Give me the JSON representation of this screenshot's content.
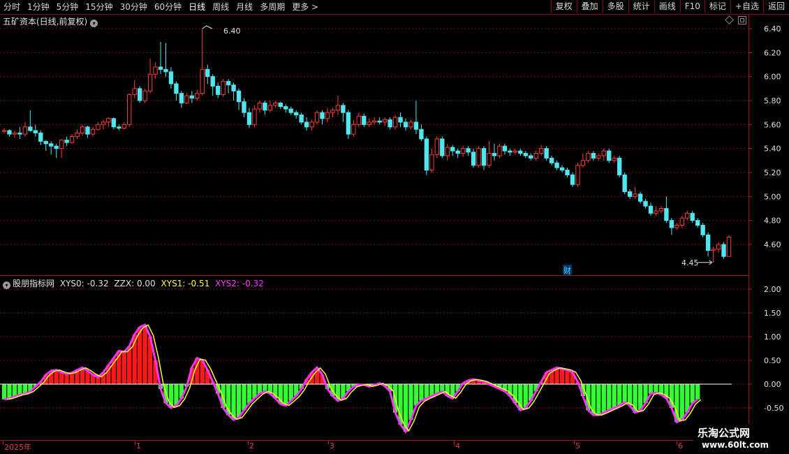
{
  "toolbar": {
    "tabs": [
      "分时",
      "1分钟",
      "5分钟",
      "15分钟",
      "30分钟",
      "60分钟",
      "日线",
      "周线",
      "月线",
      "多周期",
      "更多 >"
    ],
    "active_tab": "日线",
    "right_buttons": [
      "复权",
      "叠加",
      "多股",
      "统计",
      "画线",
      "F10",
      "标记",
      "+自选",
      "返回"
    ]
  },
  "main_chart": {
    "title": "五矿资本(日线,前复权)",
    "high_label": "6.40",
    "low_label": "4.45",
    "finance_marker": "财",
    "price_ticks": [
      "6.40",
      "6.20",
      "6.00",
      "5.80",
      "5.60",
      "5.40",
      "5.20",
      "5.00",
      "4.80",
      "4.60"
    ],
    "colors": {
      "up": "#ff3a3a",
      "down": "#4fe6f0",
      "grid": "#7a1010"
    }
  },
  "indicator": {
    "name": "股朋指标网",
    "xys0_label": "XYS0:",
    "xys0_value": "-0.32",
    "zzx_label": "ZZX:",
    "zzx_value": "0.00",
    "xys1_label": "XYS1:",
    "xys1_value": "-0.51",
    "xys2_label": "XYS2:",
    "xys2_value": "-0.32",
    "ticks": [
      "2.00",
      "1.50",
      "1.00",
      "0.50",
      "0.00",
      "-0.50"
    ],
    "colors": {
      "pos": "#ff1a1a",
      "neg": "#33ff33",
      "line1": "#ffff33",
      "line2": "#ff33ff"
    }
  },
  "date_axis": {
    "labels": [
      "2025年",
      "1",
      "2",
      "3",
      "4",
      "5",
      "6"
    ]
  },
  "watermark": {
    "line1": "乐淘公式网",
    "line2": "www.60lt.com"
  },
  "chart_data": {
    "type": "candlestick",
    "title": "五矿资本(日线,前复权)",
    "ylim": [
      4.45,
      6.45
    ],
    "y_ticks": [
      4.6,
      4.8,
      5.0,
      5.2,
      5.4,
      5.6,
      5.8,
      6.0,
      6.2,
      6.4
    ],
    "max_marker": 6.4,
    "min_marker": 4.45,
    "candles": [
      [
        5.55,
        5.55,
        5.57,
        5.53
      ],
      [
        5.55,
        5.52,
        5.56,
        5.5
      ],
      [
        5.52,
        5.53,
        5.55,
        5.49
      ],
      [
        5.53,
        5.52,
        5.58,
        5.48
      ],
      [
        5.52,
        5.58,
        5.62,
        5.5
      ],
      [
        5.58,
        5.55,
        5.72,
        5.54
      ],
      [
        5.55,
        5.53,
        5.6,
        5.5
      ],
      [
        5.53,
        5.46,
        5.55,
        5.43
      ],
      [
        5.46,
        5.44,
        5.47,
        5.38
      ],
      [
        5.44,
        5.42,
        5.46,
        5.35
      ],
      [
        5.42,
        5.4,
        5.44,
        5.32
      ],
      [
        5.4,
        5.47,
        5.48,
        5.32
      ],
      [
        5.47,
        5.45,
        5.5,
        5.42
      ],
      [
        5.45,
        5.5,
        5.52,
        5.44
      ],
      [
        5.5,
        5.53,
        5.56,
        5.48
      ],
      [
        5.53,
        5.58,
        5.6,
        5.51
      ],
      [
        5.58,
        5.52,
        5.59,
        5.49
      ],
      [
        5.52,
        5.56,
        5.58,
        5.5
      ],
      [
        5.56,
        5.6,
        5.62,
        5.55
      ],
      [
        5.6,
        5.62,
        5.64,
        5.56
      ],
      [
        5.62,
        5.65,
        5.66,
        5.58
      ],
      [
        5.65,
        5.58,
        5.66,
        5.56
      ],
      [
        5.58,
        5.57,
        5.6,
        5.55
      ],
      [
        5.57,
        5.6,
        5.62,
        5.56
      ],
      [
        5.6,
        5.85,
        5.86,
        5.58
      ],
      [
        5.85,
        5.9,
        5.97,
        5.82
      ],
      [
        5.9,
        5.8,
        5.92,
        5.78
      ],
      [
        5.8,
        5.88,
        5.9,
        5.78
      ],
      [
        5.88,
        6.02,
        6.15,
        5.86
      ],
      [
        6.02,
        6.08,
        6.12,
        5.98
      ],
      [
        6.08,
        6.06,
        6.29,
        6.02
      ],
      [
        6.06,
        6.04,
        6.28,
        6.0
      ],
      [
        6.04,
        5.94,
        6.08,
        5.9
      ],
      [
        5.94,
        5.86,
        5.96,
        5.8
      ],
      [
        5.86,
        5.78,
        5.88,
        5.74
      ],
      [
        5.78,
        5.84,
        5.86,
        5.77
      ],
      [
        5.84,
        5.82,
        5.88,
        5.78
      ],
      [
        5.82,
        5.86,
        5.89,
        5.8
      ],
      [
        5.86,
        6.06,
        6.4,
        5.84
      ],
      [
        6.06,
        6.0,
        6.1,
        5.94
      ],
      [
        6.0,
        5.92,
        6.02,
        5.84
      ],
      [
        5.92,
        5.85,
        5.95,
        5.82
      ],
      [
        5.85,
        5.96,
        5.98,
        5.83
      ],
      [
        5.96,
        5.93,
        5.98,
        5.86
      ],
      [
        5.93,
        5.88,
        5.95,
        5.8
      ],
      [
        5.88,
        5.79,
        5.9,
        5.72
      ],
      [
        5.79,
        5.7,
        5.82,
        5.66
      ],
      [
        5.7,
        5.6,
        5.74,
        5.57
      ],
      [
        5.6,
        5.73,
        5.76,
        5.58
      ],
      [
        5.73,
        5.78,
        5.8,
        5.7
      ],
      [
        5.78,
        5.72,
        5.8,
        5.68
      ],
      [
        5.72,
        5.76,
        5.8,
        5.7
      ],
      [
        5.76,
        5.78,
        5.8,
        5.74
      ],
      [
        5.78,
        5.75,
        5.79,
        5.73
      ],
      [
        5.75,
        5.73,
        5.77,
        5.7
      ],
      [
        5.73,
        5.7,
        5.75,
        5.68
      ],
      [
        5.7,
        5.68,
        5.72,
        5.65
      ],
      [
        5.68,
        5.62,
        5.7,
        5.6
      ],
      [
        5.62,
        5.58,
        5.66,
        5.55
      ],
      [
        5.58,
        5.62,
        5.64,
        5.55
      ],
      [
        5.62,
        5.7,
        5.72,
        5.6
      ],
      [
        5.7,
        5.65,
        5.72,
        5.6
      ],
      [
        5.65,
        5.7,
        5.74,
        5.62
      ],
      [
        5.7,
        5.72,
        5.74,
        5.66
      ],
      [
        5.72,
        5.76,
        5.84,
        5.68
      ],
      [
        5.76,
        5.7,
        5.78,
        5.62
      ],
      [
        5.7,
        5.52,
        5.72,
        5.48
      ],
      [
        5.52,
        5.6,
        5.64,
        5.5
      ],
      [
        5.6,
        5.67,
        5.7,
        5.58
      ],
      [
        5.67,
        5.6,
        5.69,
        5.58
      ],
      [
        5.6,
        5.62,
        5.65,
        5.58
      ],
      [
        5.62,
        5.63,
        5.66,
        5.6
      ],
      [
        5.63,
        5.62,
        5.66,
        5.6
      ],
      [
        5.62,
        5.64,
        5.66,
        5.59
      ],
      [
        5.64,
        5.58,
        5.66,
        5.56
      ],
      [
        5.58,
        5.66,
        5.68,
        5.56
      ],
      [
        5.66,
        5.62,
        5.7,
        5.58
      ],
      [
        5.62,
        5.58,
        5.65,
        5.55
      ],
      [
        5.58,
        5.62,
        5.64,
        5.56
      ],
      [
        5.62,
        5.56,
        5.8,
        5.52
      ],
      [
        5.56,
        5.48,
        5.6,
        5.46
      ],
      [
        5.48,
        5.22,
        5.5,
        5.18
      ],
      [
        5.22,
        5.35,
        5.4,
        5.2
      ],
      [
        5.35,
        5.48,
        5.5,
        5.32
      ],
      [
        5.48,
        5.34,
        5.5,
        5.32
      ],
      [
        5.34,
        5.41,
        5.44,
        5.3
      ],
      [
        5.41,
        5.38,
        5.43,
        5.34
      ],
      [
        5.38,
        5.36,
        5.4,
        5.32
      ],
      [
        5.36,
        5.4,
        5.42,
        5.33
      ],
      [
        5.4,
        5.37,
        5.42,
        5.34
      ],
      [
        5.37,
        5.26,
        5.4,
        5.24
      ],
      [
        5.26,
        5.4,
        5.42,
        5.24
      ],
      [
        5.4,
        5.26,
        5.42,
        5.22
      ],
      [
        5.26,
        5.36,
        5.46,
        5.24
      ],
      [
        5.36,
        5.34,
        5.44,
        5.3
      ],
      [
        5.34,
        5.42,
        5.44,
        5.32
      ],
      [
        5.42,
        5.38,
        5.44,
        5.35
      ],
      [
        5.38,
        5.37,
        5.4,
        5.34
      ],
      [
        5.37,
        5.38,
        5.4,
        5.35
      ],
      [
        5.38,
        5.36,
        5.4,
        5.34
      ],
      [
        5.36,
        5.34,
        5.38,
        5.32
      ],
      [
        5.34,
        5.32,
        5.36,
        5.3
      ],
      [
        5.32,
        5.36,
        5.38,
        5.3
      ],
      [
        5.36,
        5.4,
        5.43,
        5.34
      ],
      [
        5.4,
        5.32,
        5.42,
        5.3
      ],
      [
        5.32,
        5.28,
        5.34,
        5.26
      ],
      [
        5.28,
        5.24,
        5.3,
        5.22
      ],
      [
        5.24,
        5.22,
        5.26,
        5.2
      ],
      [
        5.22,
        5.18,
        5.24,
        5.16
      ],
      [
        5.18,
        5.1,
        5.2,
        5.08
      ],
      [
        5.1,
        5.26,
        5.28,
        5.08
      ],
      [
        5.26,
        5.3,
        5.36,
        5.24
      ],
      [
        5.3,
        5.36,
        5.38,
        5.28
      ],
      [
        5.36,
        5.32,
        5.38,
        5.3
      ],
      [
        5.32,
        5.34,
        5.36,
        5.3
      ],
      [
        5.34,
        5.38,
        5.4,
        5.3
      ],
      [
        5.38,
        5.3,
        5.4,
        5.28
      ],
      [
        5.3,
        5.32,
        5.34,
        5.28
      ],
      [
        5.32,
        5.18,
        5.34,
        5.16
      ],
      [
        5.18,
        5.04,
        5.2,
        5.02
      ],
      [
        5.04,
        5.0,
        5.06,
        4.98
      ],
      [
        5.0,
        5.02,
        5.08,
        4.98
      ],
      [
        5.02,
        4.96,
        5.04,
        4.94
      ],
      [
        4.96,
        4.92,
        4.98,
        4.9
      ],
      [
        4.92,
        4.86,
        4.95,
        4.84
      ],
      [
        4.86,
        4.88,
        4.92,
        4.84
      ],
      [
        4.88,
        4.9,
        4.92,
        4.86
      ],
      [
        4.9,
        4.8,
        5.0,
        4.78
      ],
      [
        4.8,
        4.74,
        4.82,
        4.68
      ],
      [
        4.74,
        4.76,
        4.78,
        4.72
      ],
      [
        4.76,
        4.82,
        4.84,
        4.74
      ],
      [
        4.82,
        4.86,
        4.88,
        4.8
      ],
      [
        4.86,
        4.8,
        4.88,
        4.78
      ],
      [
        4.8,
        4.76,
        4.82,
        4.74
      ],
      [
        4.76,
        4.68,
        4.78,
        4.66
      ],
      [
        4.68,
        4.55,
        4.7,
        4.5
      ],
      [
        4.55,
        4.56,
        4.58,
        4.45
      ],
      [
        4.56,
        4.6,
        4.62,
        4.53
      ],
      [
        4.6,
        4.5,
        4.62,
        4.48
      ],
      [
        4.5,
        4.66,
        4.68,
        4.52
      ]
    ],
    "indicator_series": {
      "hist": [
        -0.32,
        -0.3,
        -0.26,
        -0.22,
        -0.2,
        -0.15,
        -0.05,
        0.05,
        0.2,
        0.28,
        0.3,
        0.25,
        0.22,
        0.24,
        0.3,
        0.35,
        0.28,
        0.2,
        0.15,
        0.25,
        0.4,
        0.55,
        0.7,
        0.68,
        0.8,
        1.05,
        1.2,
        1.25,
        1.0,
        0.5,
        -0.1,
        -0.4,
        -0.5,
        -0.45,
        -0.3,
        -0.05,
        0.35,
        0.55,
        0.5,
        0.3,
        0.05,
        -0.2,
        -0.5,
        -0.65,
        -0.75,
        -0.7,
        -0.55,
        -0.4,
        -0.3,
        -0.2,
        -0.15,
        -0.2,
        -0.3,
        -0.42,
        -0.45,
        -0.35,
        -0.25,
        -0.1,
        0.1,
        0.25,
        0.35,
        0.2,
        -0.1,
        -0.25,
        -0.35,
        -0.3,
        -0.15,
        -0.05,
        -0.02,
        -0.01,
        -0.05,
        -0.02,
        0.02,
        -0.04,
        -0.15,
        -0.6,
        -0.85,
        -1.0,
        -0.75,
        -0.45,
        -0.35,
        -0.3,
        -0.25,
        -0.2,
        -0.15,
        -0.25,
        -0.3,
        -0.15,
        0.02,
        0.08,
        0.1,
        0.08,
        0.05,
        0.0,
        -0.05,
        -0.1,
        -0.15,
        -0.25,
        -0.4,
        -0.55,
        -0.5,
        -0.35,
        -0.15,
        0.05,
        0.25,
        0.3,
        0.35,
        0.32,
        0.3,
        0.25,
        0.05,
        -0.25,
        -0.55,
        -0.65,
        -0.65,
        -0.6,
        -0.55,
        -0.5,
        -0.45,
        -0.38,
        -0.45,
        -0.6,
        -0.55,
        -0.4,
        -0.2,
        -0.18,
        -0.22,
        -0.3,
        -0.5,
        -0.8,
        -0.75,
        -0.6,
        -0.4,
        -0.32
      ]
    }
  }
}
